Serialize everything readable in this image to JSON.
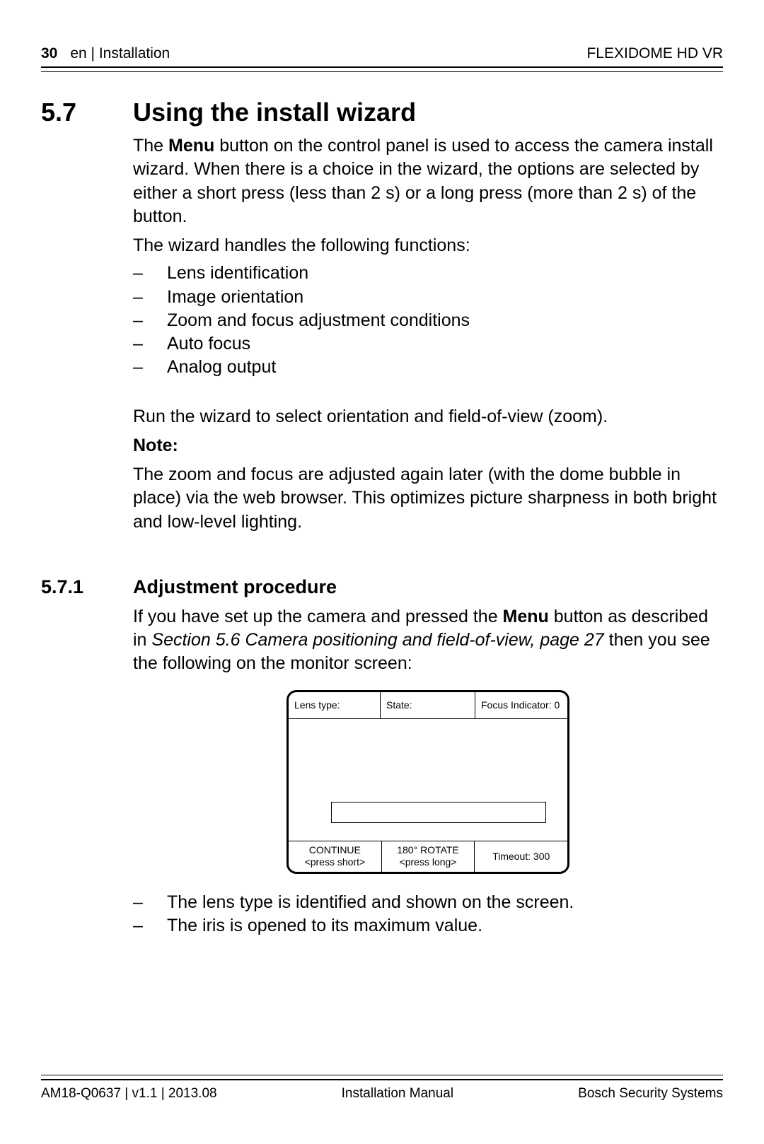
{
  "header": {
    "page_num": "30",
    "section_path": "en | Installation",
    "product": "FLEXIDOME HD VR"
  },
  "section": {
    "number": "5.7",
    "title": "Using the install wizard",
    "intro_pre": "The ",
    "intro_bold": "Menu",
    "intro_post": " button on the control panel is used to access the camera install wizard. When there is a choice in the wizard, the options are selected by either a short press (less than 2 s) or a long press (more than 2 s) of the button.",
    "lead": "The wizard handles the following functions:",
    "bullets": [
      "Lens identification",
      "Image orientation",
      "Zoom and focus adjustment conditions",
      "Auto focus",
      "Analog output"
    ],
    "run_line": "Run the wizard to select orientation and field-of-view (zoom).",
    "note_label": "Note:",
    "note_body": "The zoom and focus are adjusted again later (with the dome bubble in place) via the web browser. This optimizes picture sharpness in both bright and low-level lighting."
  },
  "subsection": {
    "number": "5.7.1",
    "title": "Adjustment procedure",
    "p_pre": "If you have set up the camera and pressed the ",
    "p_bold": "Menu",
    "p_mid": " button as described in ",
    "p_italic": "Section 5.6 Camera positioning and field-of-view, page 27",
    "p_post": " then you see the following on the monitor screen:"
  },
  "diagram": {
    "lens_type": "Lens type:",
    "state": "State:",
    "focus_indicator": "Focus Indicator: 0",
    "continue": "CONTINUE",
    "press_short": "<press short>",
    "rotate": "180° ROTATE",
    "press_long": "<press long>",
    "timeout": "Timeout: 300"
  },
  "after_bullets": [
    "The lens type is identified and shown on the screen.",
    "The iris is opened to its maximum value."
  ],
  "footer": {
    "left": "AM18-Q0637 | v1.1 | 2013.08",
    "center": "Installation Manual",
    "right": "Bosch Security Systems"
  }
}
